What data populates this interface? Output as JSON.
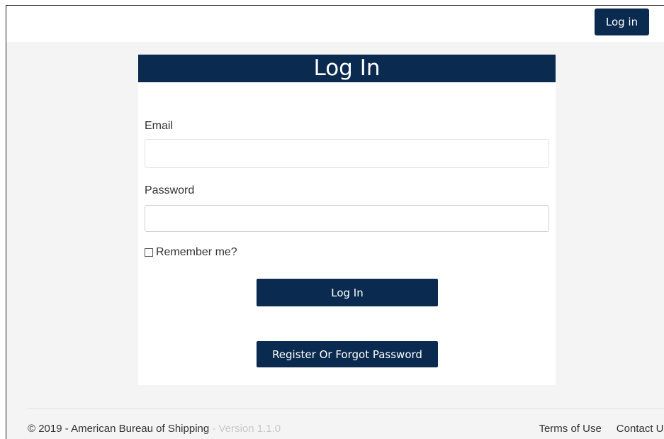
{
  "topbar": {
    "login_label": "Log in"
  },
  "card": {
    "title": "Log In",
    "email_label": "Email",
    "email_value": "",
    "password_label": "Password",
    "password_value": "",
    "remember_label": "Remember me?",
    "remember_checked": false,
    "login_button": "Log In",
    "register_button": "Register Or Forgot Password"
  },
  "footer": {
    "copyright": "© 2019 - American Bureau of Shipping",
    "version": " - Version 1.1.0",
    "links": [
      "Terms of Use",
      "Contact Us"
    ]
  },
  "colors": {
    "brand": "#0b2a4f",
    "background": "#f4f4f4"
  }
}
